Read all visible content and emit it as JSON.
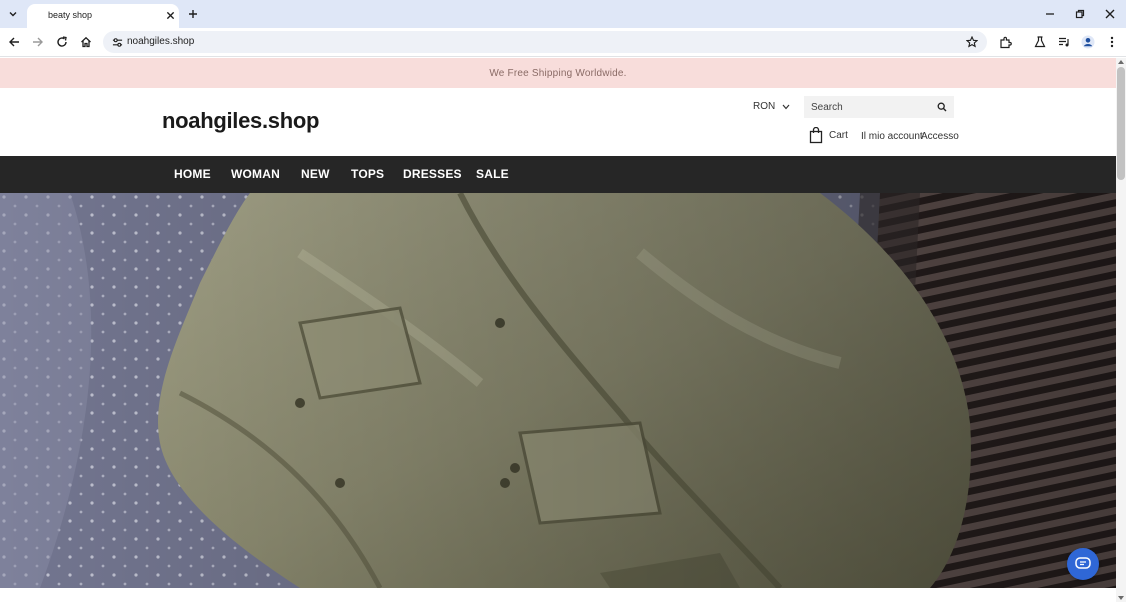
{
  "browser": {
    "tab_title": "beaty shop",
    "url": "noahgiles.shop"
  },
  "page": {
    "announcement": "We Free Shipping Worldwide.",
    "logo": "noahgiles.shop",
    "currency": "RON",
    "search_placeholder": "Search",
    "cart_label": "Cart",
    "account_label": "Il mio account",
    "login_label": "Accesso",
    "nav": [
      "HOME",
      "WOMAN",
      "NEW",
      "TOPS",
      "DRESSES",
      "SALE"
    ]
  },
  "colors": {
    "announcement_bg": "#f8dddb",
    "nav_bg": "#262626",
    "chat_button": "#2f67d6"
  },
  "icons": [
    "tab-list-icon",
    "close-icon",
    "plus-icon",
    "minimize-icon",
    "restore-icon",
    "back-icon",
    "forward-icon",
    "reload-icon",
    "home-icon",
    "site-settings-icon",
    "star-icon",
    "extensions-icon",
    "labs-icon",
    "media-icon",
    "profile-icon",
    "more-icon",
    "chevron-down-icon",
    "search-icon",
    "shopping-bag-icon",
    "chat-icon"
  ]
}
